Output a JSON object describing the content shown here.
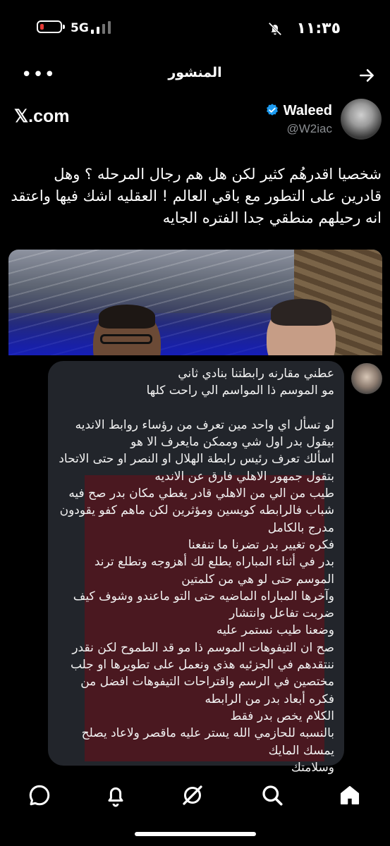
{
  "status_bar": {
    "time": "١١:٣٥",
    "network": "5G",
    "battery_level": 0.15,
    "battery_color": "#e53935",
    "silent_icon": "bell-slash-icon"
  },
  "header": {
    "title": "المنشور",
    "more_icon": "more-dots-icon",
    "back_icon": "arrow-right-icon"
  },
  "post": {
    "source": "𝕏.com",
    "author_name": "Waleed",
    "author_handle": "@W2iac",
    "verified_color": "#1d9bf0",
    "text": "شخصيا اقدرهُم كثير لكن هل هم رجال المرحله ؟ وهل قادرين على التطور مع باقي العالم ! العقليه اشك فيها واعتقد انه رحيلهم منطقي جدا الفتره الجايه"
  },
  "chat": {
    "highlight_color": "#4a1820",
    "message": "عطني مقارنه رابطتنا بنادي ثاني\nمو الموسم ذا المواسم الي راحت كلها\n\nلو تسأل اي واحد مين تعرف من رؤساء روابط الانديه\nبيقول بدر اول شي وممكن مايعرف الا هو\nاسألك تعرف رئيس رابطة الهلال او النصر او حتى الاتحاد\nبتقول جمهور الاهلي فارق عن الانديه\nطيب من الي من الاهلي قادر يغطي مكان بدر صح فيه\nشباب فالرابطه كويسين ومؤثرين لكن ماهم كفو يقودون\nمدرج بالكامل\nفكره تغيير بدر تضرنا ما تنفعنا\nبدر في أثناء المباراه يطلع لك أهزوجه وتطلع ترند\nالموسم حتى لو هي من كلمتين\nوآخرها المباراه الماضيه حتى التو ماعندو وشوف كيف\nضربت تفاعل وانتشار\nوضعنا طيب نستمر عليه\nصح ان التيفوهات الموسم ذا مو قد الطموح لكن نقدر\nننتقدهم في الجزئيه هذي ونعمل على تطويرها او جلب\nمختصين في الرسم واقتراحات التيفوهات افضل من\nفكره أبعاد بدر من الرابطه\nالكلام يخص بدر فقط\nبالنسبه للحازمي الله يستر عليه ماقصر ولاعاد يصلح\nيمسك المايك\nوسلامتك"
  },
  "tabbar": {
    "items": [
      "chat-icon",
      "bell-icon",
      "grok-icon",
      "search-icon",
      "home-icon"
    ]
  }
}
